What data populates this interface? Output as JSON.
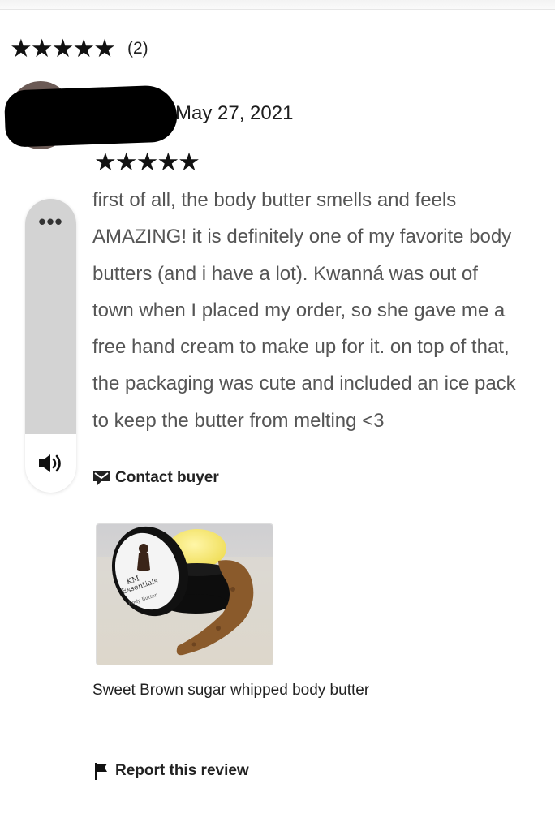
{
  "summary": {
    "stars": "★★★★★",
    "count": "(2)"
  },
  "review": {
    "date": "May 27, 2021",
    "stars": "★★★★★",
    "lines": [
      "first of all, the body butter smells and feels",
      "AMAZING! it is definitely one of my favorite body",
      "butters (and i have a lot). Kwanná was out of",
      "town when I placed my order, so she gave me a",
      "free hand cream to make up for it. on top of that,",
      "the packaging was cute and included an ice pack",
      "to keep the butter from melting <3"
    ],
    "rating": 5,
    "contact_label": "Contact buyer",
    "product_name": "Sweet Brown sugar whipped body butter",
    "product_label_text": "KM Essentials Body Butter",
    "report_label": "Report this review"
  },
  "side_panel": {
    "more_glyph": "•••",
    "icons": [
      "more-icon",
      "speaker-icon"
    ]
  },
  "icons": {
    "contact": "envelope-icon",
    "report": "flag-icon"
  }
}
